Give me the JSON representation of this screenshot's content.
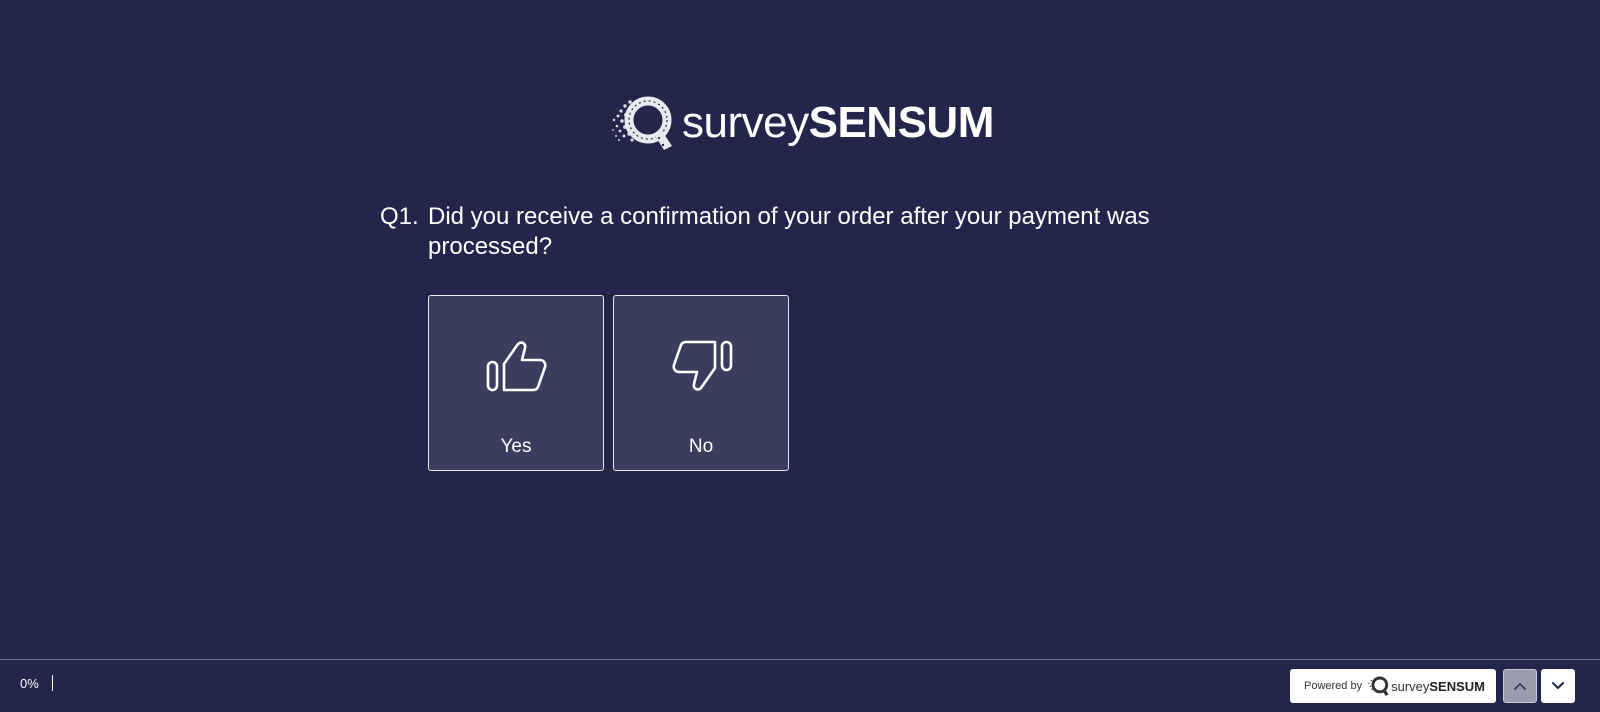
{
  "logo": {
    "mark_icon": "magnifier-q-icon",
    "text_light": "survey",
    "text_bold": "SENSUM"
  },
  "question": {
    "number": "Q1.",
    "text": "Did you receive a confirmation of your order after your payment was processed?"
  },
  "options": [
    {
      "label": "Yes",
      "icon": "thumbs-up-icon"
    },
    {
      "label": "No",
      "icon": "thumbs-down-icon"
    }
  ],
  "footer": {
    "progress": "0%",
    "powered_by": "Powered by",
    "brand_light": "survey",
    "brand_bold": "SENSUM",
    "prev_icon": "chevron-up-icon",
    "next_icon": "chevron-down-icon"
  },
  "colors": {
    "background": "#23264a",
    "option_background": "#3a3d5e",
    "option_border": "#e6e7ef",
    "text": "#ffffff"
  }
}
